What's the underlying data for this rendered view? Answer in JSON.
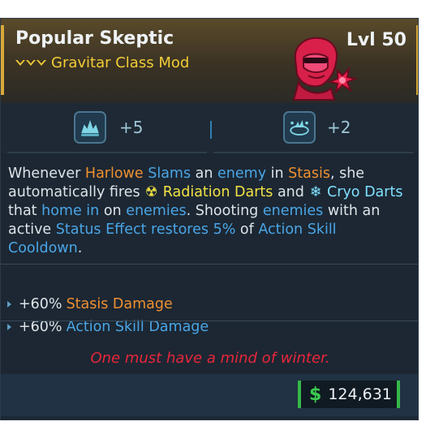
{
  "item": {
    "name": "Popular Skeptic",
    "class_mod_label": "Gravitar Class Mod",
    "level": "Lvl 50",
    "rarity_color": "#f2cc36"
  },
  "skills": [
    {
      "icon": "stasis-burst-icon",
      "bonus": "+5"
    },
    {
      "icon": "orbit-burst-icon",
      "bonus": "+2"
    }
  ],
  "description": {
    "t1": "Whenever ",
    "k1": "Harlowe",
    "t2": " ",
    "k2": "Slams",
    "t3": " an ",
    "k3": "enemy",
    "t4": " in ",
    "k4": "Stasis",
    "t5": ", she automatically fires ",
    "k5": "Radiation Darts",
    "t6": " and ",
    "k6": "Cryo Darts",
    "t7": " that ",
    "k7": "home in",
    "t8": " on ",
    "k8": "enemies",
    "t9": ". Shooting ",
    "k9": "enemies",
    "t10": " with an active ",
    "k10": "Status Effect",
    "t11": " ",
    "k11": "restores 5%",
    "t12": " of ",
    "k12": "Action Skill Cooldown",
    "t13": "."
  },
  "bullets": [
    {
      "value": "+60%",
      "label": "Stasis Damage",
      "color": "#f09030"
    },
    {
      "value": "+60%",
      "label": "Action Skill Damage",
      "color": "#4aa6e6"
    }
  ],
  "flavor_text": "One must have a mind of winter.",
  "price": {
    "symbol": "$",
    "value": "124,631"
  }
}
